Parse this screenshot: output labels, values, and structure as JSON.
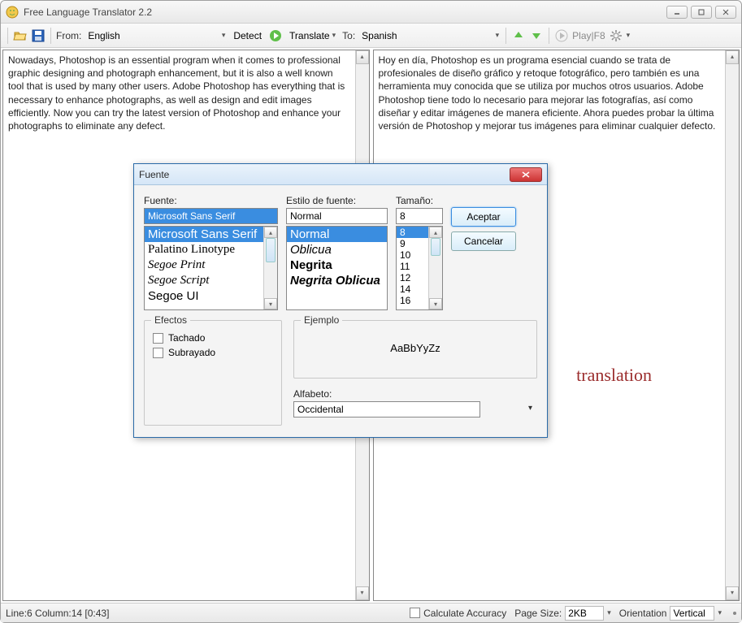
{
  "window": {
    "title": "Free Language Translator 2.2"
  },
  "toolbar": {
    "from_label": "From:",
    "from_lang": "English",
    "detect_label": "Detect",
    "translate_label": "Translate",
    "to_label": "To:",
    "to_lang": "Spanish",
    "play_label": "Play|F8"
  },
  "source_text": "Nowadays, Photoshop is an essential program when it comes to professional graphic designing and photograph enhancement, but it is also a well known tool that is used by many other users. Adobe Photoshop has everything that is necessary to enhance photographs, as well as design and edit images efficiently. Now you can try the latest version of Photoshop and enhance your photographs to eliminate any defect.",
  "target_text": "Hoy en día, Photoshop es un programa esencial cuando se trata de profesionales de diseño gráfico y retoque fotográfico, pero también es una herramienta muy conocida que se utiliza por muchos otros usuarios. Adobe Photoshop tiene todo lo necesario para mejorar las fotografías, así como diseñar y editar imágenes de manera eficiente. Ahora puedes probar la última versión de Photoshop y mejorar tus imágenes para eliminar cualquier defecto.",
  "watermark": "translation",
  "status": {
    "position": "Line:6 Column:14 [0:43]",
    "calc_label": "Calculate Accuracy",
    "page_size_label": "Page Size:",
    "page_size_value": "2KB",
    "orientation_label": "Orientation",
    "orientation_value": "Vertical"
  },
  "font_dialog": {
    "title": "Fuente",
    "font_label": "Fuente:",
    "font_value": "Microsoft Sans Serif",
    "fonts": [
      "Microsoft Sans Serif",
      "Palatino Linotype",
      "Segoe Print",
      "Segoe Script",
      "Segoe UI"
    ],
    "style_label": "Estilo de fuente:",
    "style_value": "Normal",
    "styles": [
      "Normal",
      "Oblicua",
      "Negrita",
      "Negrita Oblicua"
    ],
    "size_label": "Tamaño:",
    "size_value": "8",
    "sizes": [
      "8",
      "9",
      "10",
      "11",
      "12",
      "14",
      "16"
    ],
    "ok": "Aceptar",
    "cancel": "Cancelar",
    "effects_label": "Efectos",
    "tachado": "Tachado",
    "subrayado": "Subrayado",
    "ejemplo_label": "Ejemplo",
    "sample": "AaBbYyZz",
    "alfabeto_label": "Alfabeto:",
    "alfabeto_value": "Occidental"
  }
}
